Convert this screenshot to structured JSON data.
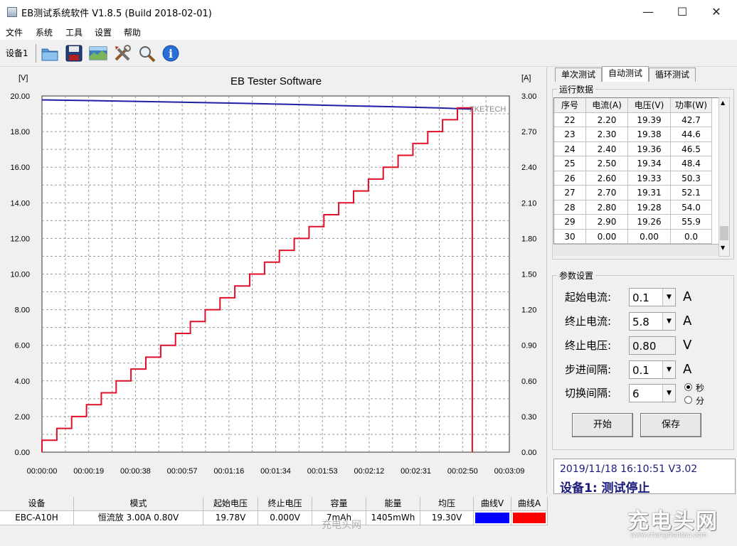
{
  "window": {
    "title": "EB测试系统软件 V1.8.5 (Build 2018-02-01)",
    "min": "—",
    "max": "☐",
    "close": "✕"
  },
  "menu": [
    "文件",
    "系统",
    "工具",
    "设置",
    "帮助"
  ],
  "toolbar": {
    "device_label": "设备1",
    "buttons": [
      "folder-icon",
      "save-icon",
      "chart-image-icon",
      "tools-icon",
      "zoom-icon",
      "info-icon"
    ]
  },
  "colors": {
    "voltage_line": "#1f1fa8",
    "current_line": "#e0102a",
    "curve_v_swatch": "#0000ff",
    "curve_a_swatch": "#ff0000",
    "status_text": "#1a1a7a"
  },
  "chart_data": {
    "type": "line",
    "title": "EB Tester Software",
    "watermark": "ZKETECH",
    "ylabel": "[V]",
    "y2label": "[A]",
    "ylim": [
      0,
      20
    ],
    "y2lim": [
      0,
      3
    ],
    "y_ticks": [
      "0.00",
      "2.00",
      "4.00",
      "6.00",
      "8.00",
      "10.00",
      "12.00",
      "14.00",
      "16.00",
      "18.00",
      "20.00"
    ],
    "y2_ticks": [
      "0.00",
      "0.30",
      "0.60",
      "0.90",
      "1.20",
      "1.50",
      "1.80",
      "2.10",
      "2.40",
      "2.70",
      "3.00"
    ],
    "x_ticks": [
      "00:00:00",
      "00:00:19",
      "00:00:38",
      "00:00:57",
      "00:01:16",
      "00:01:34",
      "00:01:53",
      "00:02:12",
      "00:02:31",
      "00:02:50",
      "00:03:09"
    ],
    "xlim_seconds": [
      0,
      189
    ],
    "grid": true,
    "series": [
      {
        "name": "V",
        "axis": "left",
        "x_seconds": [
          0,
          20,
          40,
          60,
          80,
          100,
          120,
          140,
          160,
          174,
          174
        ],
        "values": [
          19.78,
          19.74,
          19.69,
          19.64,
          19.59,
          19.53,
          19.46,
          19.4,
          19.33,
          19.26,
          19.26
        ]
      },
      {
        "name": "A",
        "axis": "right",
        "step_seconds": 6,
        "start_current": 0.1,
        "step_current": 0.1,
        "steps": 29,
        "end_seconds": 174,
        "cutoff": true
      }
    ]
  },
  "tabs": [
    "单次测试",
    "自动测试",
    "循环测试"
  ],
  "run_data": {
    "title": "运行数据",
    "headers": [
      "序号",
      "电流(A)",
      "电压(V)",
      "功率(W)"
    ],
    "rows": [
      [
        "22",
        "2.20",
        "19.39",
        "42.7"
      ],
      [
        "23",
        "2.30",
        "19.38",
        "44.6"
      ],
      [
        "24",
        "2.40",
        "19.36",
        "46.5"
      ],
      [
        "25",
        "2.50",
        "19.34",
        "48.4"
      ],
      [
        "26",
        "2.60",
        "19.33",
        "50.3"
      ],
      [
        "27",
        "2.70",
        "19.31",
        "52.1"
      ],
      [
        "28",
        "2.80",
        "19.28",
        "54.0"
      ],
      [
        "29",
        "2.90",
        "19.26",
        "55.9"
      ],
      [
        "30",
        "0.00",
        "0.00",
        "0.0"
      ]
    ]
  },
  "params": {
    "title": "参数设置",
    "start_current": {
      "label": "起始电流:",
      "value": "0.1",
      "unit": "A"
    },
    "end_current": {
      "label": "终止电流:",
      "value": "5.8",
      "unit": "A"
    },
    "end_voltage": {
      "label": "终止电压:",
      "value": "0.80",
      "unit": "V"
    },
    "step": {
      "label": "步进间隔:",
      "value": "0.1",
      "unit": "A"
    },
    "switch": {
      "label": "切换间隔:",
      "value": "6"
    },
    "radio_sec": "秒",
    "radio_min": "分",
    "start_button": "开始",
    "save_button": "保存"
  },
  "status": {
    "time": "2019/11/18 16:10:51  V3.02",
    "message": "设备1: 测试停止"
  },
  "bottom": {
    "headers": [
      "设备",
      "模式",
      "起始电压",
      "终止电压",
      "容量",
      "能量",
      "均压",
      "曲线V",
      "曲线A"
    ],
    "values": [
      "EBC-A10H",
      "恒流放  3.00A  0.80V",
      "19.78V",
      "0.000V",
      "7mAh",
      "1405mWh",
      "19.30V",
      "",
      ""
    ]
  },
  "watermark_text": "充电头网",
  "logo": {
    "main": "充电头网",
    "sub": "www.chongdiantou.com"
  }
}
